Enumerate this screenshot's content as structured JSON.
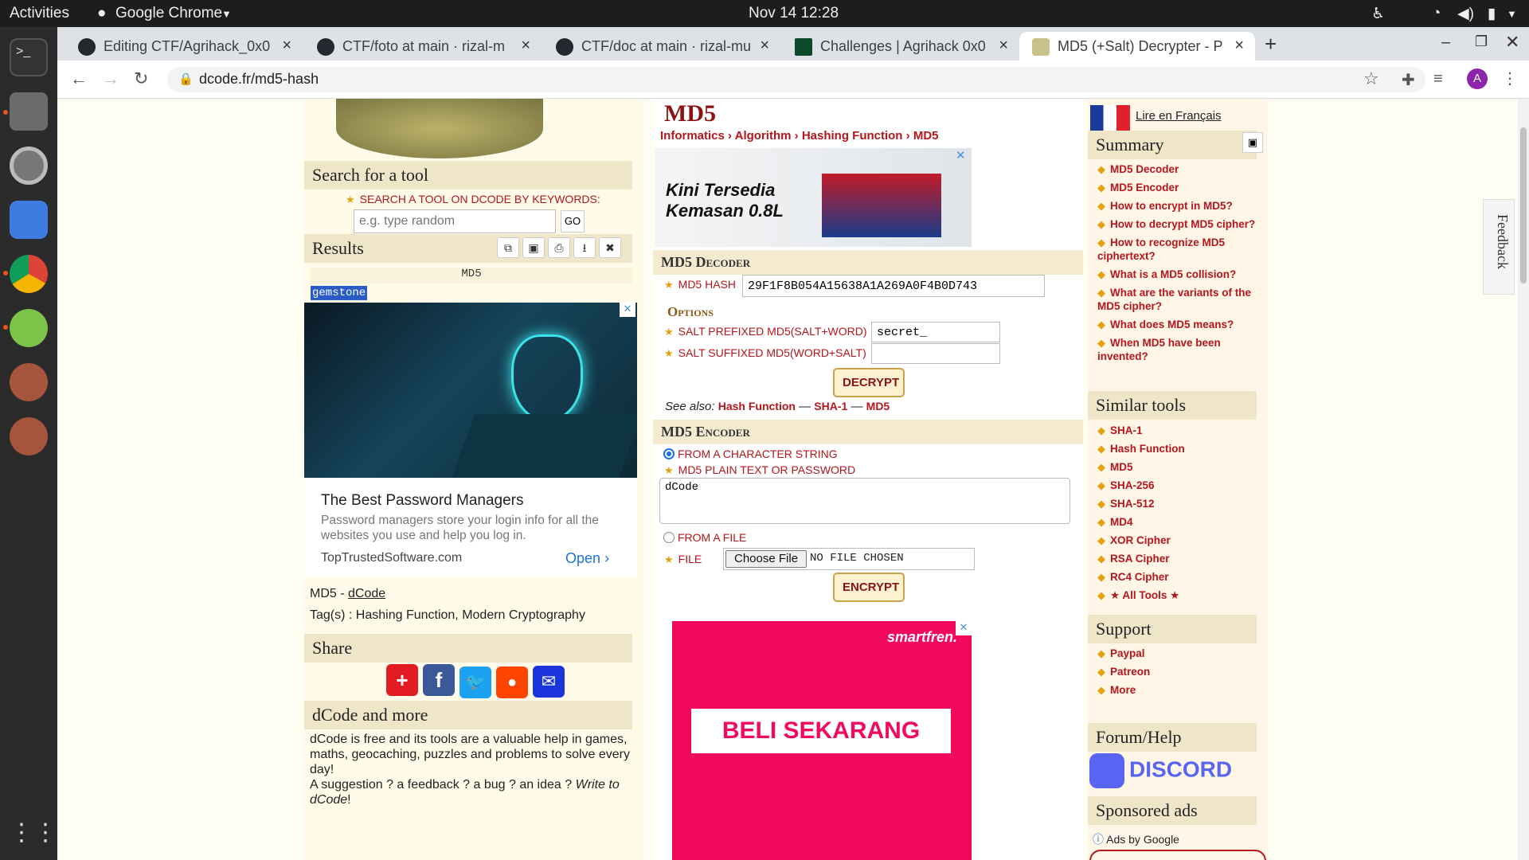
{
  "system": {
    "activities": "Activities",
    "app": "Google Chrome",
    "clock": "Nov 14  12:28"
  },
  "browser": {
    "tabs": [
      {
        "title": "Editing CTF/Agrihack_0x0"
      },
      {
        "title": "CTF/foto at main · rizal-m"
      },
      {
        "title": "CTF/doc at main · rizal-mu"
      },
      {
        "title": "Challenges | Agrihack 0x0"
      },
      {
        "title": "MD5 (+Salt) Decrypter - P"
      }
    ],
    "url": "dcode.fr/md5-hash",
    "new_tab": "+",
    "profile_initial": "A"
  },
  "left": {
    "search_title": "Search for a tool",
    "search_label": "SEARCH A TOOL ON DCODE BY KEYWORDS:",
    "search_placeholder": "e.g. type random",
    "go": "GO",
    "results_title": "Results",
    "results_head": "MD5",
    "result_value": "gemstone",
    "ad_title": "The Best Password Managers",
    "ad_text": "Password managers store your login info for all the websites you use and help you log in.",
    "ad_domain": "TopTrustedSoftware.com",
    "ad_open": "Open",
    "credit_prefix": "MD5 - ",
    "credit_link": "dCode",
    "tags": "Tag(s) : Hashing Function, Modern Cryptography",
    "share_title": "Share",
    "more_title": "dCode and more",
    "more_text1": "dCode is free and its tools are a valuable help in games, maths, geocaching, puzzles and problems to solve every day!",
    "more_text2": "A suggestion ? a feedback ? a bug ? an idea ? ",
    "more_link": "Write to dCode",
    "more_end": "!"
  },
  "main": {
    "title": "MD5",
    "breadcrumb": [
      "Informatics",
      "Algorithm",
      "Hashing Function",
      "MD5"
    ],
    "ad_headline1": "Kini Tersedia",
    "ad_headline2": "Kemasan 0.8L",
    "decoder_title": "MD5 Decoder",
    "hash_label": "MD5 HASH",
    "hash_value": "29F1F8B054A15638A1A269A0F4B0D743",
    "options_title": "Options",
    "prefix_label": "SALT PREFIXED MD5(SALT+WORD)",
    "prefix_value": "secret_",
    "suffix_label": "SALT SUFFIXED MD5(WORD+SALT)",
    "suffix_value": "",
    "decrypt": "DECRYPT",
    "see_also": "See also: ",
    "see_links": [
      "Hash Function",
      "SHA-1",
      "MD5"
    ],
    "encoder_title": "MD5 Encoder",
    "from_string": "FROM A CHARACTER STRING",
    "plain_label": "MD5 PLAIN TEXT OR PASSWORD",
    "plain_value": "dCode",
    "from_file": "FROM A FILE",
    "file_label": "FILE",
    "choose_file": "Choose File",
    "no_file": "NO FILE CHOSEN",
    "encrypt": "ENCRYPT",
    "ad2_brand": "smartfren.",
    "ad2_cta": "BELI SEKARANG"
  },
  "right": {
    "lang_link": "Lire en Français",
    "summary_title": "Summary",
    "summary": [
      "MD5 Decoder",
      "MD5 Encoder",
      "How to encrypt in MD5?",
      "How to decrypt MD5 cipher?",
      "How to recognize MD5 ciphertext?",
      "What is a MD5 collision?",
      "What are the variants of the MD5 cipher?",
      "What does MD5 means?",
      "When MD5 have been invented?"
    ],
    "similar_title": "Similar tools",
    "similar": [
      "SHA-1",
      "Hash Function",
      "MD5",
      "SHA-256",
      "SHA-512",
      "MD4",
      "XOR Cipher",
      "RSA Cipher",
      "RC4 Cipher",
      "★ All Tools ★"
    ],
    "support_title": "Support",
    "support": [
      "Paypal",
      "Patreon",
      "More"
    ],
    "forum_title": "Forum/Help",
    "discord": "DISCORD",
    "sponsored_title": "Sponsored ads",
    "ads_by": "Ads by Google",
    "feedback": "Feedback"
  },
  "colors": {
    "accent": "#b5161c",
    "section_bg": "#efe6c9",
    "ad_pink": "#f2095e"
  }
}
